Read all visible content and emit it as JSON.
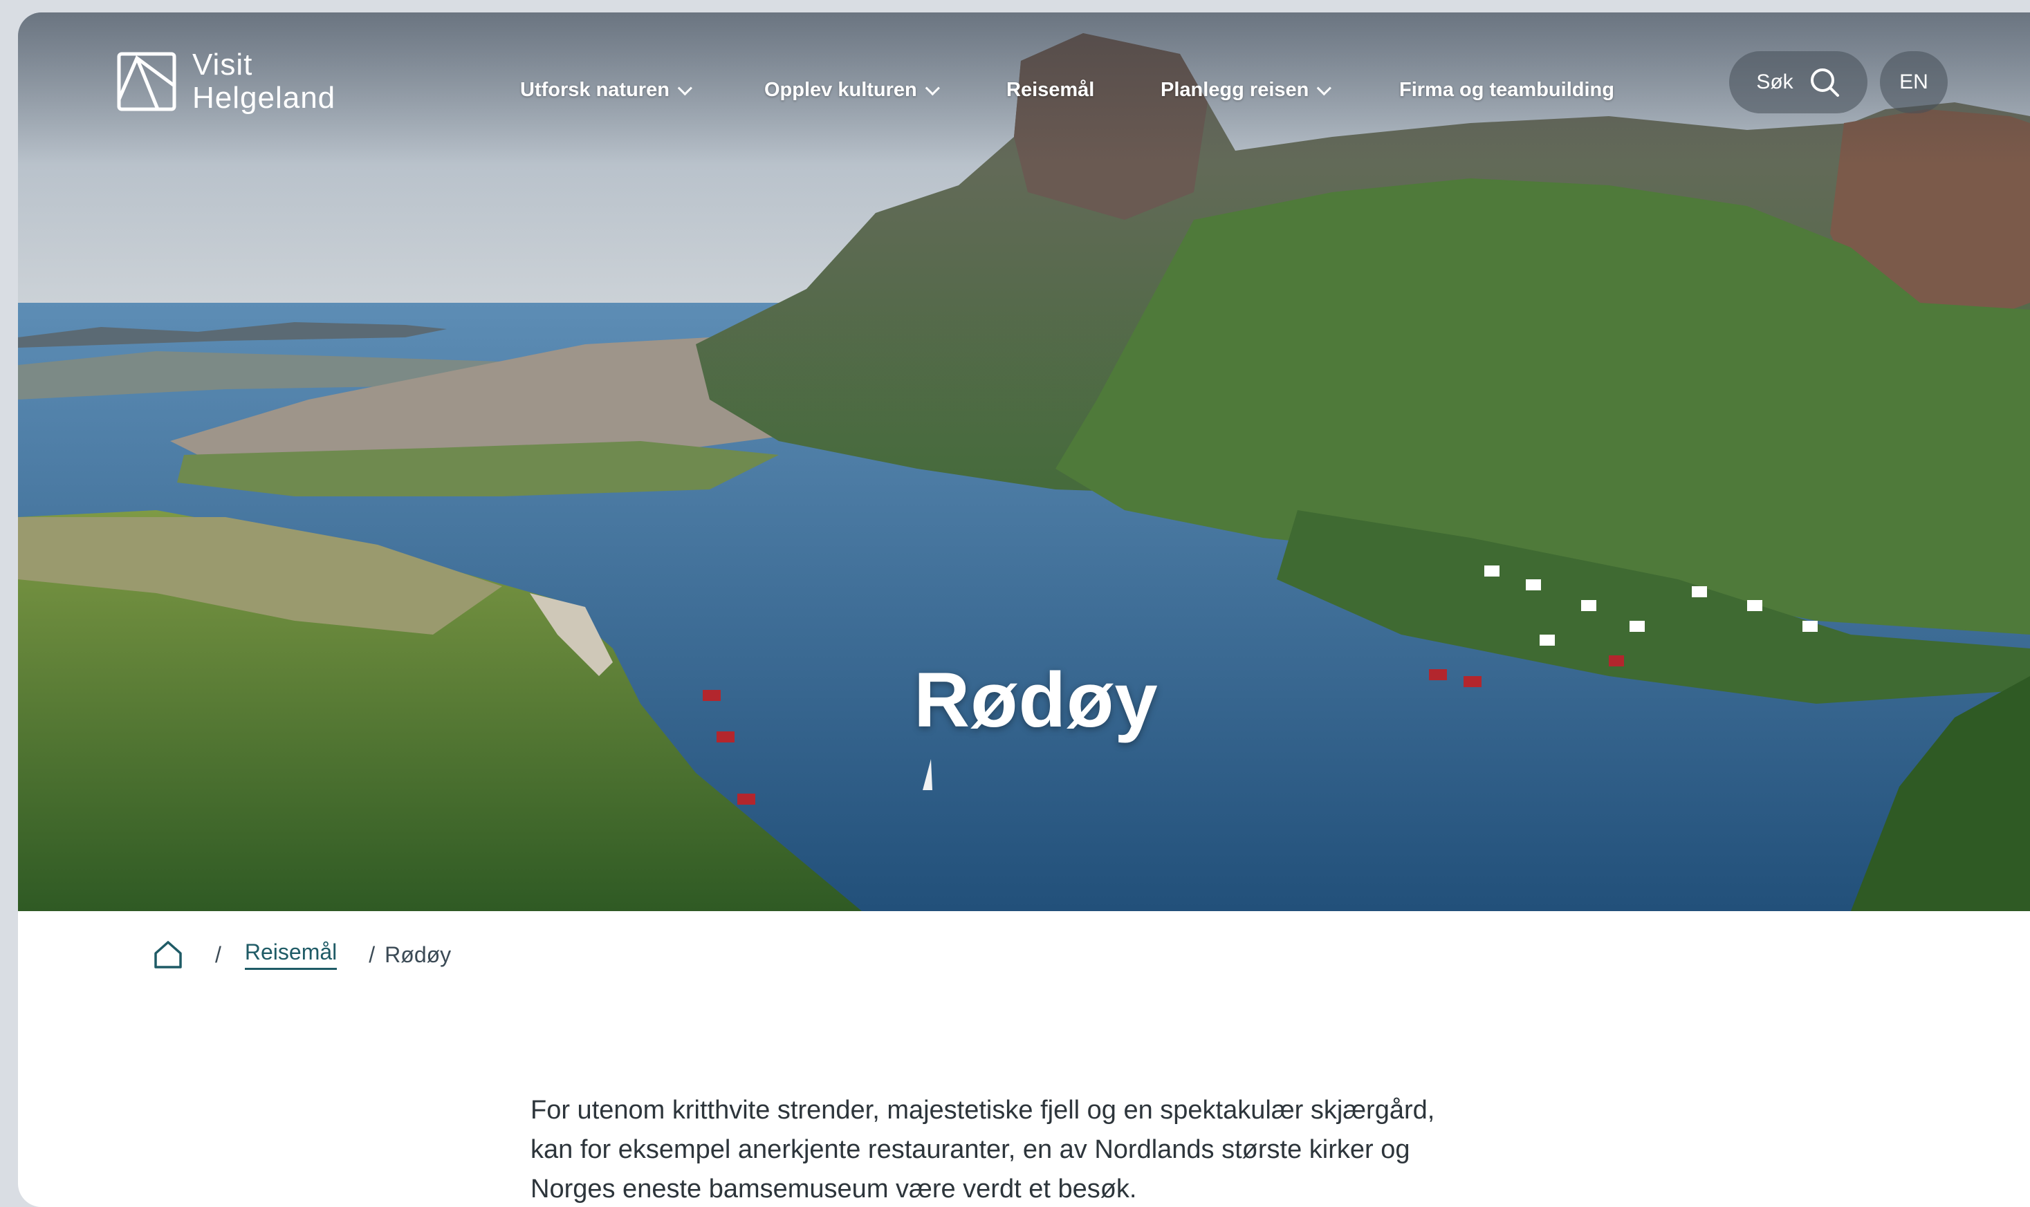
{
  "header": {
    "logo": {
      "line1": "Visit",
      "line2": "Helgeland"
    },
    "nav": [
      {
        "label": "Utforsk naturen",
        "dropdown": true
      },
      {
        "label": "Opplev kulturen",
        "dropdown": true
      },
      {
        "label": "Reisemål",
        "dropdown": false
      },
      {
        "label": "Planlegg reisen",
        "dropdown": true
      },
      {
        "label": "Firma og teambuilding",
        "dropdown": false
      }
    ],
    "search_label": "Søk",
    "language_label": "EN"
  },
  "hero": {
    "title": "Rødøy"
  },
  "breadcrumb": {
    "home_icon": "home-icon",
    "separator": "/",
    "items": [
      "Reisemål",
      "Rødøy"
    ]
  },
  "intro": {
    "lines": [
      "For utenom kritthvite strender, majestetiske fjell og en spektakulær skjærgård,",
      "kan for eksempel anerkjente restauranter, en av Nordlands største kirker og",
      "Norges eneste bamsemuseum være verdt et besøk."
    ]
  },
  "colors": {
    "link": "#1f5b66",
    "text": "#2d353b",
    "pill_bg": "#464e58"
  }
}
